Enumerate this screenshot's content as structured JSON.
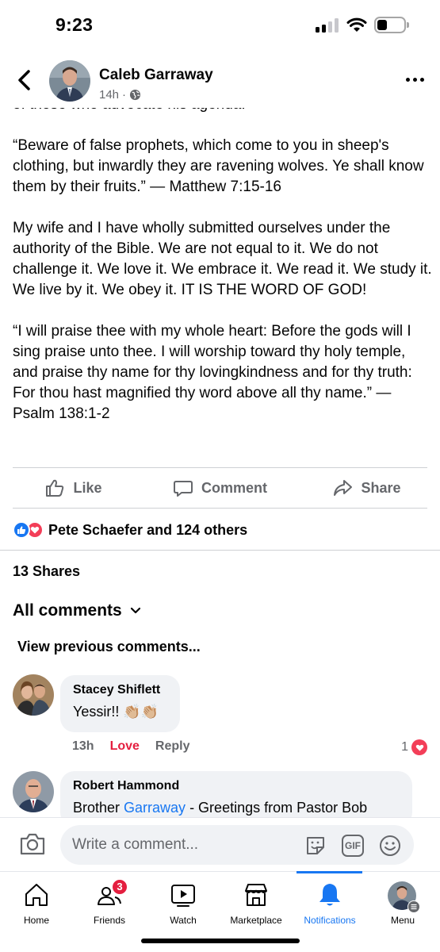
{
  "status_bar": {
    "time": "9:23"
  },
  "post": {
    "author": "Caleb Garraway",
    "time_ago": "14h",
    "meta_separator": "·",
    "partial_line": "of those who advocate his agenda.",
    "paragraphs": [
      "“Beware of false prophets, which come to you in sheep's clothing, but inwardly they are ravening wolves. Ye shall know them by their fruits.” — Matthew 7:15-16",
      "My wife and I have wholly submitted ourselves under the authority of the Bible. We are not equal to it. We do not challenge it. We love it. We embrace it. We read it. We study it. We live by it. We obey it. IT IS THE WORD OF GOD!",
      "“I will praise thee with my whole heart: Before the gods will I sing praise unto thee. I will worship toward thy holy temple, and praise thy name for thy lovingkindness and for thy truth: For thou hast magnified thy word above all thy name.” — Psalm 138:1-2"
    ]
  },
  "actions": {
    "like": "Like",
    "comment": "Comment",
    "share": "Share"
  },
  "reactions": {
    "text": "Pete Schaefer and 124 others"
  },
  "shares": "13 Shares",
  "comments_filter": "All comments",
  "view_previous": "View previous comments...",
  "comments": [
    {
      "author": "Stacey Shiflett",
      "text": "Yessir!!",
      "emoji": "👏🏼👏🏼",
      "time": "13h",
      "love": "Love",
      "reply": "Reply",
      "reaction_count": "1"
    },
    {
      "author": "Robert Hammond",
      "text_prefix": "Brother ",
      "mention": "Garraway",
      "text_suffix": " - Greetings from Pastor Bob"
    }
  ],
  "composer": {
    "placeholder": "Write a comment...",
    "gif": "GIF"
  },
  "tabs": [
    {
      "label": "Home",
      "icon": "home-icon"
    },
    {
      "label": "Friends",
      "icon": "friends-icon",
      "badge": "3"
    },
    {
      "label": "Watch",
      "icon": "watch-icon"
    },
    {
      "label": "Marketplace",
      "icon": "marketplace-icon"
    },
    {
      "label": "Notifications",
      "icon": "bell-icon",
      "active": true
    },
    {
      "label": "Menu",
      "icon": "menu-avatar-icon"
    }
  ],
  "colors": {
    "accent": "#1877f2",
    "love": "#f33e58",
    "secondary_text": "#65676b",
    "bubble": "#f0f2f5"
  }
}
